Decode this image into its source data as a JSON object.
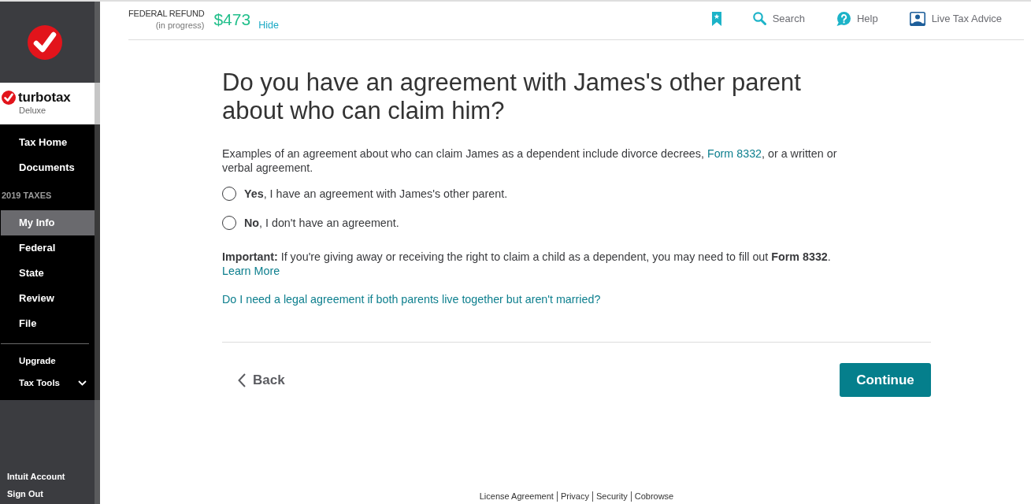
{
  "sidebar": {
    "brand": "turbotax",
    "edition": "Deluxe",
    "top_items": [
      {
        "label": "Tax Home",
        "selected": false
      },
      {
        "label": "Documents",
        "selected": false
      }
    ],
    "section": {
      "label": "2019 TAXES",
      "items": [
        {
          "label": "My Info",
          "selected": true
        },
        {
          "label": "Federal",
          "selected": false
        },
        {
          "label": "State",
          "selected": false
        },
        {
          "label": "Review",
          "selected": false
        },
        {
          "label": "File",
          "selected": false
        }
      ]
    },
    "tools": [
      {
        "label": "Upgrade",
        "kind": "link",
        "selected": false
      },
      {
        "label": "Tax Tools",
        "kind": "dropdown",
        "selected": false,
        "expanded": false
      }
    ],
    "account_links": [
      "Intuit Account",
      "Sign Out"
    ]
  },
  "header": {
    "refund_label": "FEDERAL REFUND",
    "refund_status": "(in progress)",
    "refund_amount": "$473",
    "hide_link": "Hide",
    "actions": [
      {
        "kind": "bookmark"
      },
      {
        "kind": "search",
        "label": "Search"
      },
      {
        "kind": "help",
        "label": "Help"
      },
      {
        "kind": "advice",
        "label": "Live Tax Advice"
      }
    ]
  },
  "question": {
    "title": "Do you have an agreement with James's other parent about who can claim him?",
    "description": {
      "before": "Examples of an agreement about who can claim James as a dependent include divorce decrees, ",
      "link": "Form 8332",
      "after": ", or a written or verbal agreement."
    },
    "options": [
      {
        "label": "**Yes**, I have an agreement with James's other parent.",
        "selected": false
      },
      {
        "label": "**No**, I don't have an agreement.",
        "selected": false
      }
    ],
    "note": {
      "text": "**Important:** If you're giving away or receiving the right to claim a child as a dependent, you may need to fill out **Form 8332**.",
      "link": "Learn More"
    },
    "help_link": "Do I need a legal agreement if both parents live together but aren't married?"
  },
  "navigation": {
    "back": "Back",
    "continue": "Continue"
  },
  "footer_links": [
    "License Agreement",
    "Privacy",
    "Security",
    "Cobrowse"
  ]
}
